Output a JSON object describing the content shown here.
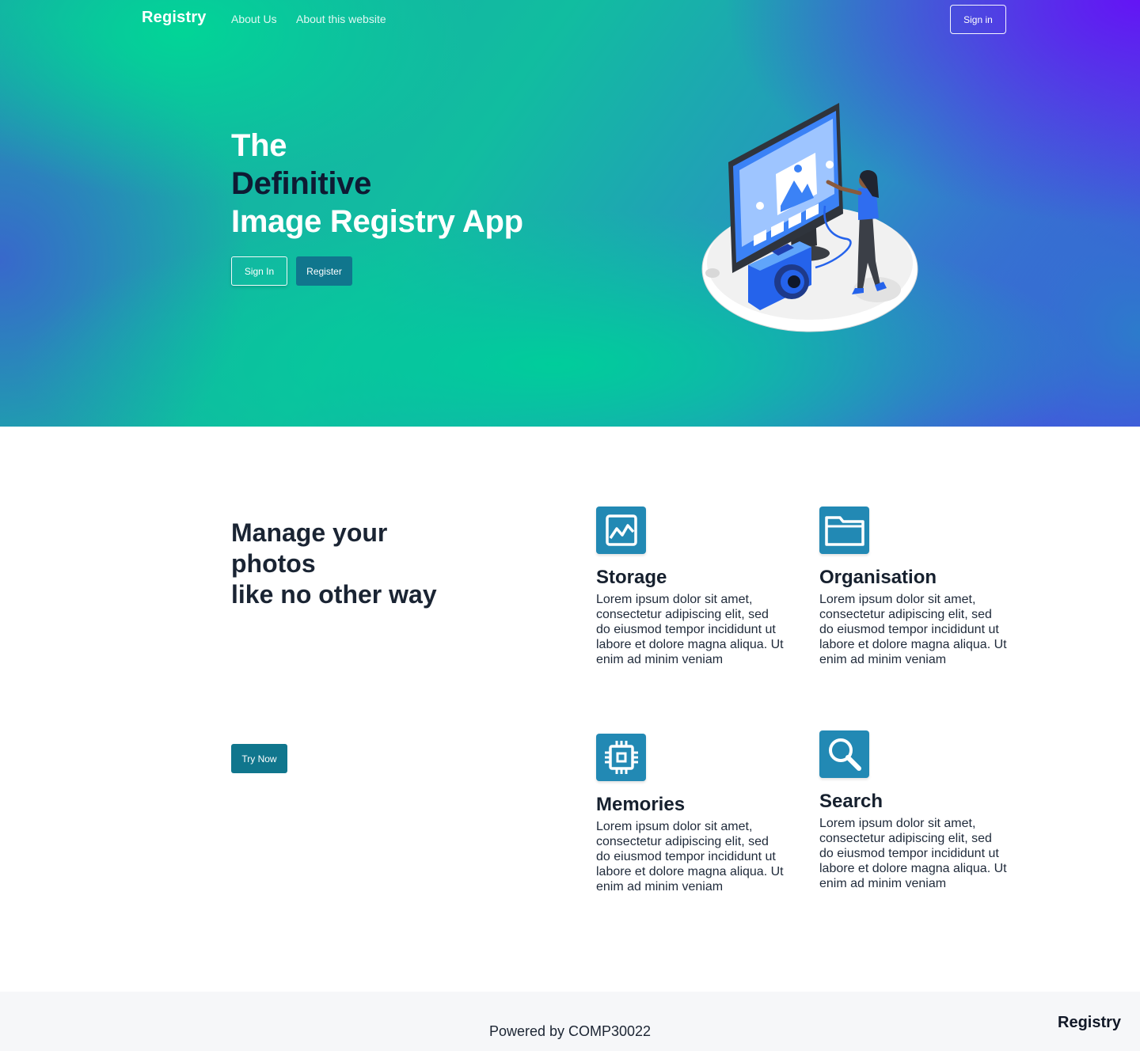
{
  "nav": {
    "brand": "Registry",
    "links": [
      "About Us",
      "About this website"
    ],
    "signin_label": "Sign in"
  },
  "hero": {
    "title_lines": [
      "The",
      "Definitive",
      "Image Registry App"
    ],
    "signin_label": "Sign In",
    "register_label": "Register"
  },
  "features": {
    "title_lines": [
      "Manage your",
      "photos",
      "like no other way"
    ],
    "try_label": "Try Now",
    "items": [
      {
        "title": "Storage",
        "icon": "image-icon",
        "text": "Lorem ipsum dolor sit amet, consectetur adipiscing elit, sed do eiusmod tempor incididunt ut labore et dolore magna aliqua. Ut enim ad minim veniam"
      },
      {
        "title": "Organisation",
        "icon": "folder-icon",
        "text": "Lorem ipsum dolor sit amet, consectetur adipiscing elit, sed do eiusmod tempor incididunt ut labore et dolore magna aliqua. Ut enim ad minim veniam"
      },
      {
        "title": "Memories",
        "icon": "chip-icon",
        "text": "Lorem ipsum dolor sit amet, consectetur adipiscing elit, sed do eiusmod tempor incididunt ut labore et dolore magna aliqua. Ut enim ad minim veniam"
      },
      {
        "title": "Search",
        "icon": "search-icon",
        "text": "Lorem ipsum dolor sit amet, consectetur adipiscing elit, sed do eiusmod tempor incididunt ut labore et dolore magna aliqua. Ut enim ad minim veniam"
      }
    ]
  },
  "footer": {
    "text": "Powered by COMP30022",
    "brand": "Registry"
  },
  "colors": {
    "accent": "#10768d",
    "icon_bg": "#2289b4",
    "hero_green": "#00cc99",
    "hero_purple": "#6414f5"
  }
}
